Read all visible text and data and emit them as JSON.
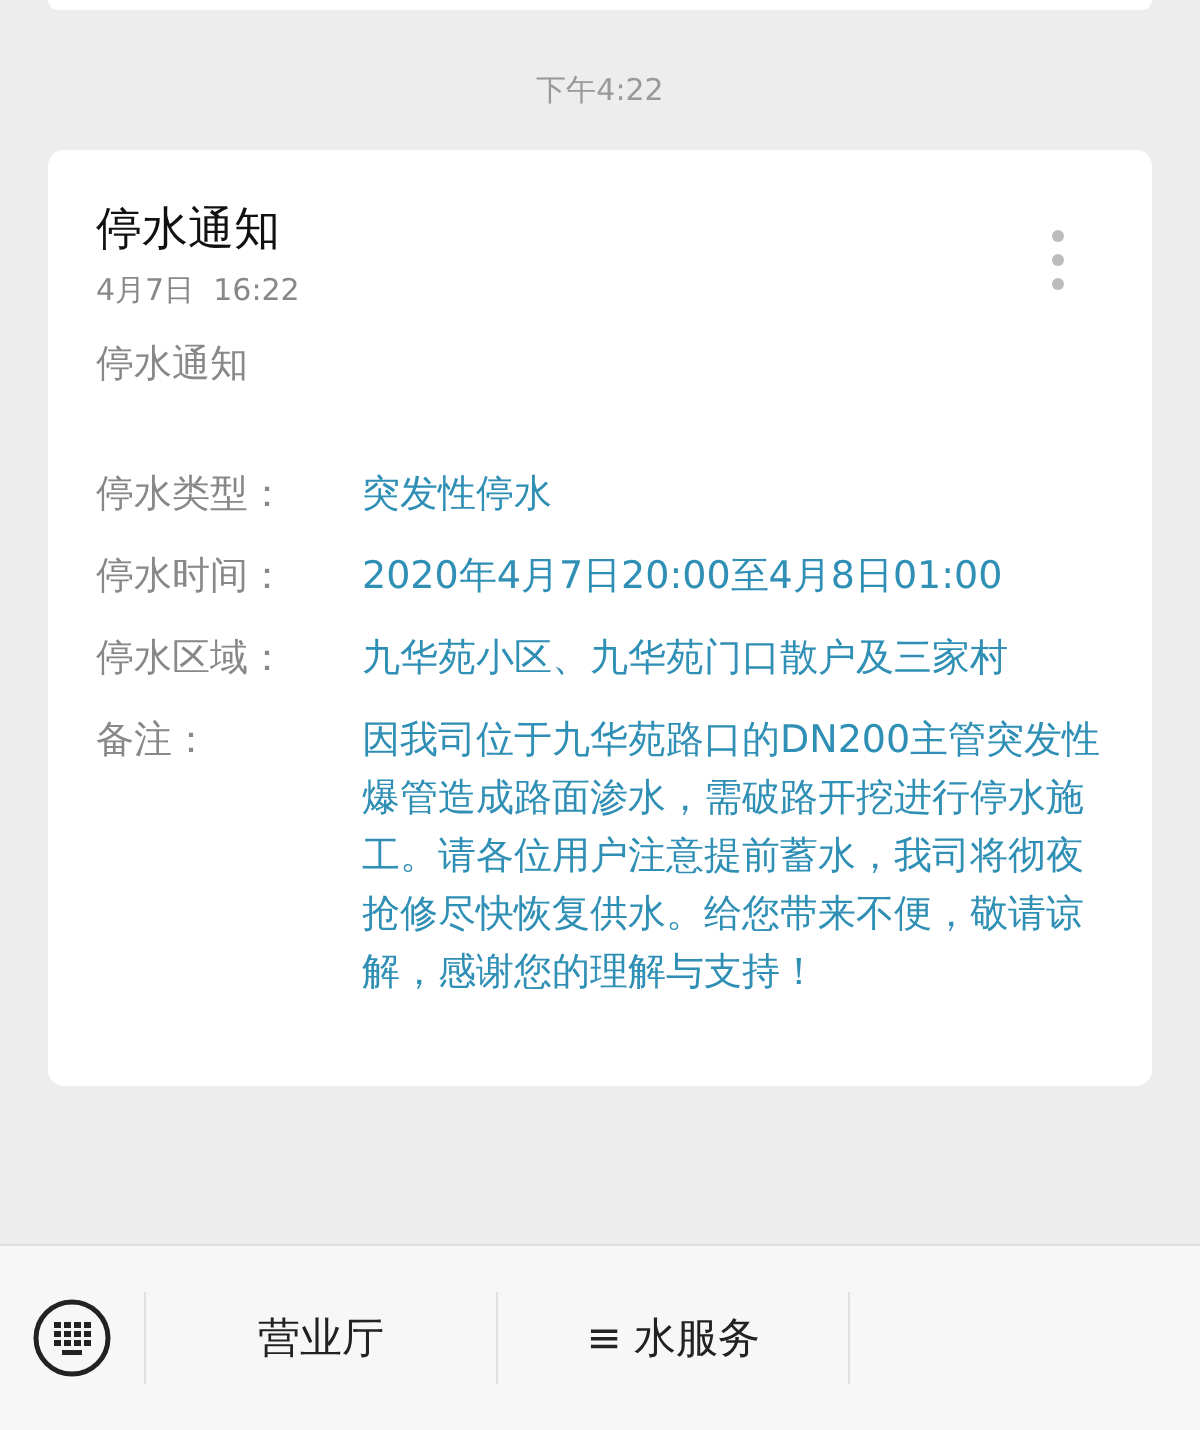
{
  "timestamp": "下午4:22",
  "message": {
    "title": "停水通知",
    "datetime": "4月7日  16:22",
    "subtitle": "停水通知",
    "fields": [
      {
        "label": "停水类型：",
        "value": "突发性停水"
      },
      {
        "label": "停水时间：",
        "value": "2020年4月7日20:00至4月8日01:00"
      },
      {
        "label": "停水区域：",
        "value": "九华苑小区、九华苑门口散户及三家村"
      },
      {
        "label": "备注：",
        "value": "因我司位于九华苑路口的DN200主管突发性爆管造成路面渗水，需破路开挖进行停水施工。请各位用户注意提前蓄水，我司将彻夜抢修尽快恢复供水。给您带来不便，敬请谅解，感谢您的理解与支持！"
      }
    ]
  },
  "menu_bar": {
    "items": [
      {
        "label": "营业厅",
        "kind": "plain"
      },
      {
        "label": "水服务",
        "kind": "menu",
        "icon": "≡"
      }
    ]
  }
}
